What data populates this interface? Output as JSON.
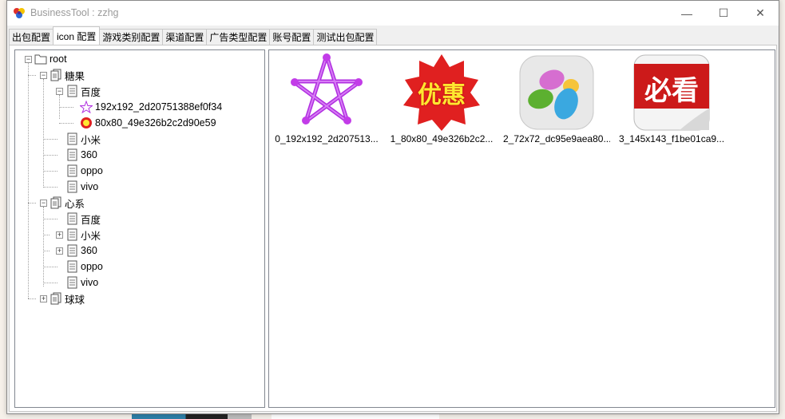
{
  "window": {
    "title": "BusinessTool : zzhg",
    "minimize_symbol": "—",
    "maximize_symbol": "☐",
    "close_symbol": "✕"
  },
  "tabs": [
    {
      "label": "出包配置",
      "active": false
    },
    {
      "label": "icon 配置",
      "active": true
    },
    {
      "label": "游戏类别配置",
      "active": false
    },
    {
      "label": "渠道配置",
      "active": false
    },
    {
      "label": "广告类型配置",
      "active": false
    },
    {
      "label": "账号配置",
      "active": false
    },
    {
      "label": "测试出包配置",
      "active": false
    }
  ],
  "tree": {
    "root": "root",
    "game1": {
      "label": "糖果",
      "channels": {
        "baidu": {
          "label": "百度",
          "icons": [
            "192x192_2d20751388ef0f34",
            "80x80_49e326b2c2d90e59"
          ]
        },
        "xiaomi": "小米",
        "c360": "360",
        "oppo": "oppo",
        "vivo": "vivo"
      }
    },
    "game2": {
      "label": "心系",
      "channels": {
        "baidu": "百度",
        "xiaomi": "小米",
        "c360": "360",
        "oppo": "oppo",
        "vivo": "vivo"
      }
    },
    "game3": {
      "label": "球球"
    }
  },
  "gallery": {
    "items": [
      {
        "caption": "0_192x192_2d207513...",
        "icon": "star-icon"
      },
      {
        "caption": "1_80x80_49e326b2c2...",
        "icon": "discount-badge-icon",
        "badge_text": "优惠"
      },
      {
        "caption": "2_72x72_dc95e9aea80...",
        "icon": "jellybean-icon"
      },
      {
        "caption": "3_145x143_f1be01ca9...",
        "icon": "bikan-icon",
        "badge_text": "必看"
      }
    ]
  },
  "colors": {
    "star": "#b02ee0",
    "badge_red": "#e02020",
    "badge_yellow": "#ffe830",
    "bikan_red": "#cc1a1a"
  }
}
